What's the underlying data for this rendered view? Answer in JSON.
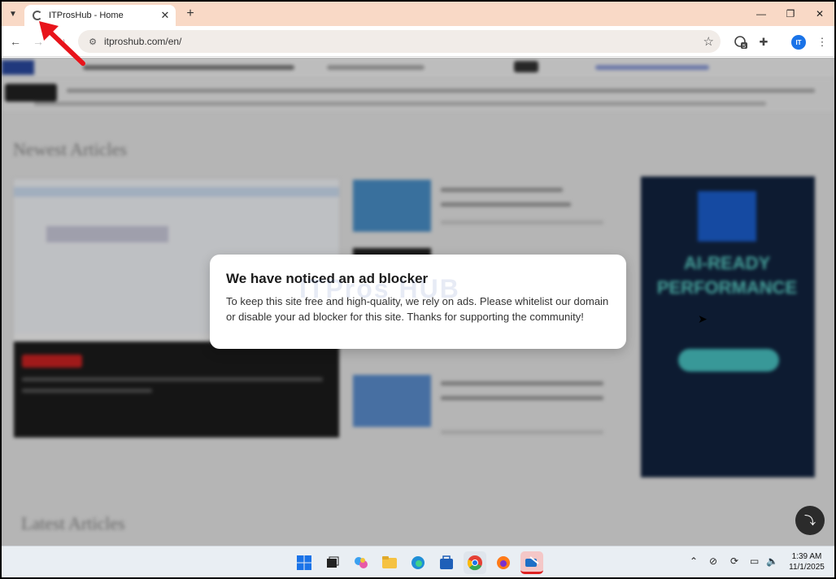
{
  "browser": {
    "tab_title": "ITProsHub - Home",
    "url": "itproshub.com/en/",
    "extension_badge": "5",
    "profile_initials": "IT"
  },
  "modal": {
    "title": "We have noticed an ad blocker",
    "body": "To keep this site free and high-quality, we rely on ads. Please whitelist our domain or disable your ad blocker for this site. Thanks for supporting the community!"
  },
  "taskbar": {
    "time": "1:39 AM",
    "date": "11/1/2025"
  },
  "colors": {
    "tabstrip": "#f9d9c6",
    "accent": "#1a73e8",
    "annotation_arrow": "#e8141b"
  }
}
